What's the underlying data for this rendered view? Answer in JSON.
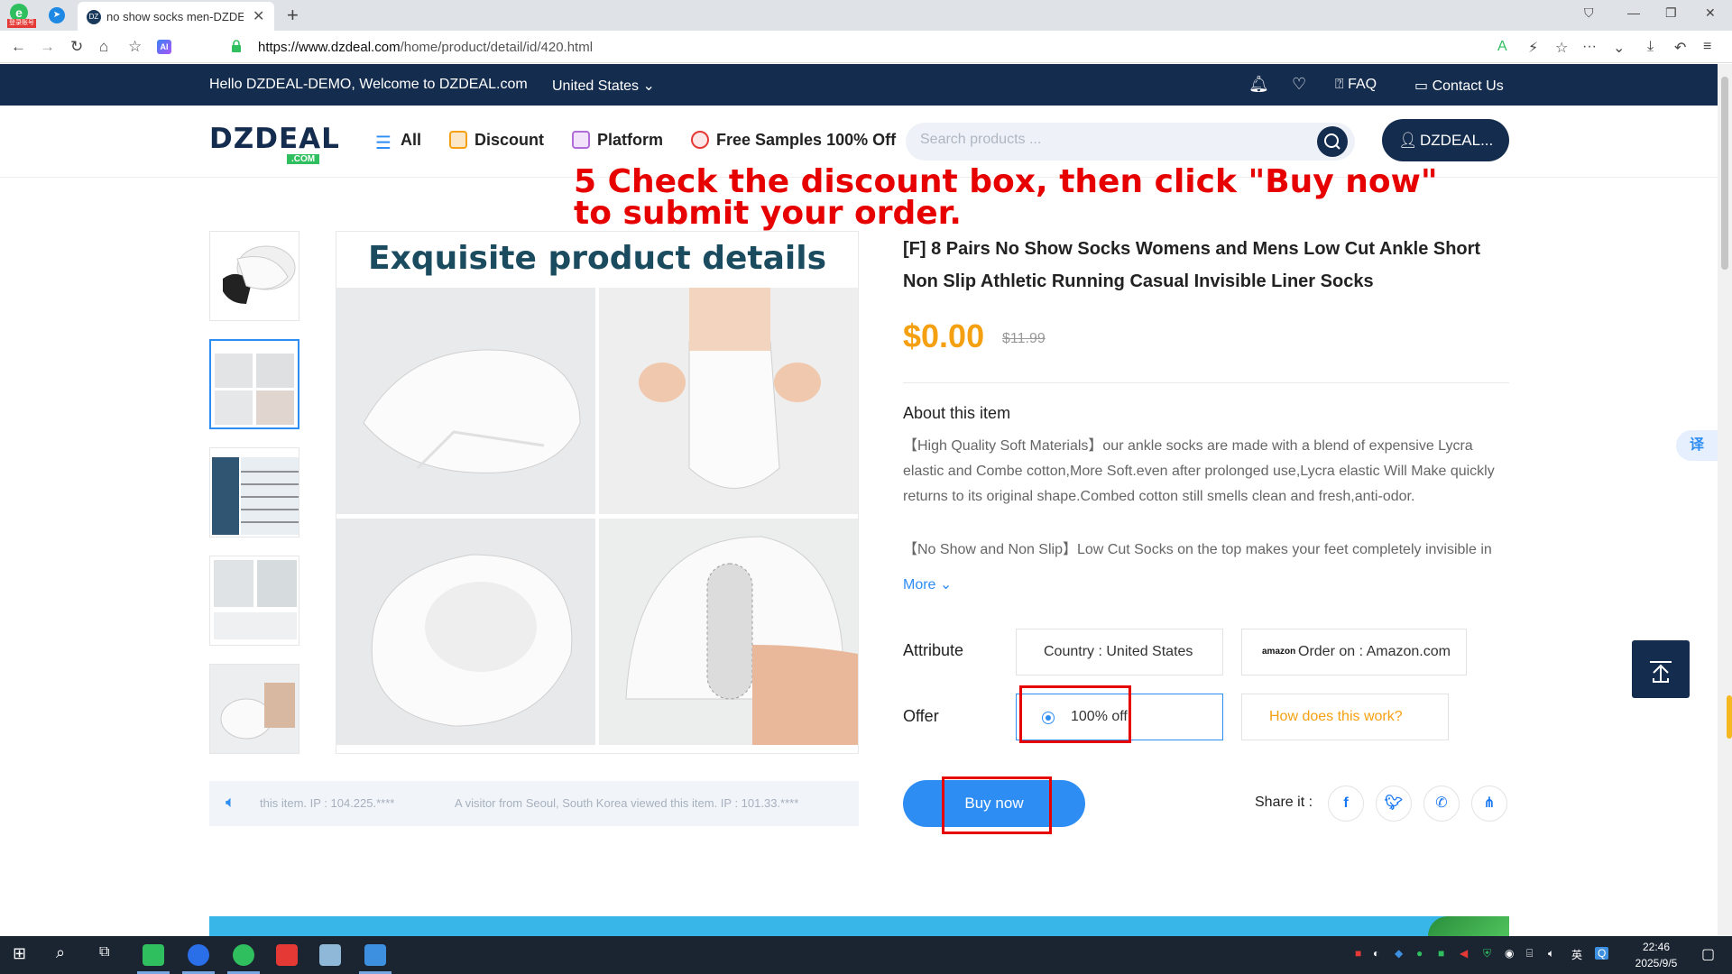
{
  "browser": {
    "app_badge": "登录账号",
    "tab_title": "no show socks men-DZDEAL",
    "tab_favicon": "DZ",
    "url_domain": "https://www.dzdeal.com",
    "url_path": "/home/product/detail/id/420.html",
    "ai_label": "AI"
  },
  "topbar": {
    "welcome": "Hello DZDEAL-DEMO, Welcome to DZDEAL.com",
    "country": "United States",
    "faq": "FAQ",
    "contact": "Contact Us"
  },
  "header": {
    "logo_main": "DZDEAL",
    "logo_sub": ".COM",
    "nav_all": "All",
    "nav_discount": "Discount",
    "nav_platform": "Platform",
    "nav_free": "Free Samples 100% Off",
    "search_placeholder": "Search products ...",
    "account": "DZDEAL..."
  },
  "annotation": "5 Check the discount box, then click \"Buy now\" to submit your order.",
  "gallery": {
    "main_heading": "Exquisite product details"
  },
  "ticker": {
    "item1": "this item.   IP : 104.225.****",
    "item2": "A visitor from Seoul, South Korea viewed this item.   IP : 101.33.****"
  },
  "product": {
    "title": "[F] 8 Pairs No Show Socks Womens and Mens Low Cut Ankle Short Non Slip Athletic Running Casual Invisible Liner Socks",
    "price": "$0.00",
    "old_price": "$11.99",
    "about_heading": "About this item",
    "about_p1": "【High Quality Soft Materials】our ankle socks are made with a blend of expensive Lycra elastic and Combe cotton,More Soft.even after prolonged use,Lycra elastic Will Make quickly returns to its original shape.Combed cotton still smells clean and fresh,anti-odor.",
    "about_p2": "【No Show and Non Slip】Low Cut Socks on the top makes your feet completely invisible in",
    "more": "More",
    "attribute_label": "Attribute",
    "country_attr": "Country : United States",
    "order_on_logo": "amazon",
    "order_on": "Order on : Amazon.com",
    "offer_label": "Offer",
    "offer_value": "100% off",
    "how_link": "How does this work?",
    "buy_now": "Buy now",
    "share_label": "Share it :"
  },
  "translate": "译",
  "taskbar": {
    "time": "22:46",
    "date": "2025/9/5",
    "ime": "英"
  },
  "colors": {
    "navy": "#142c4e",
    "accent_blue": "#2e8df3",
    "price_orange": "#f5a010",
    "annotation_red": "#e60000"
  }
}
